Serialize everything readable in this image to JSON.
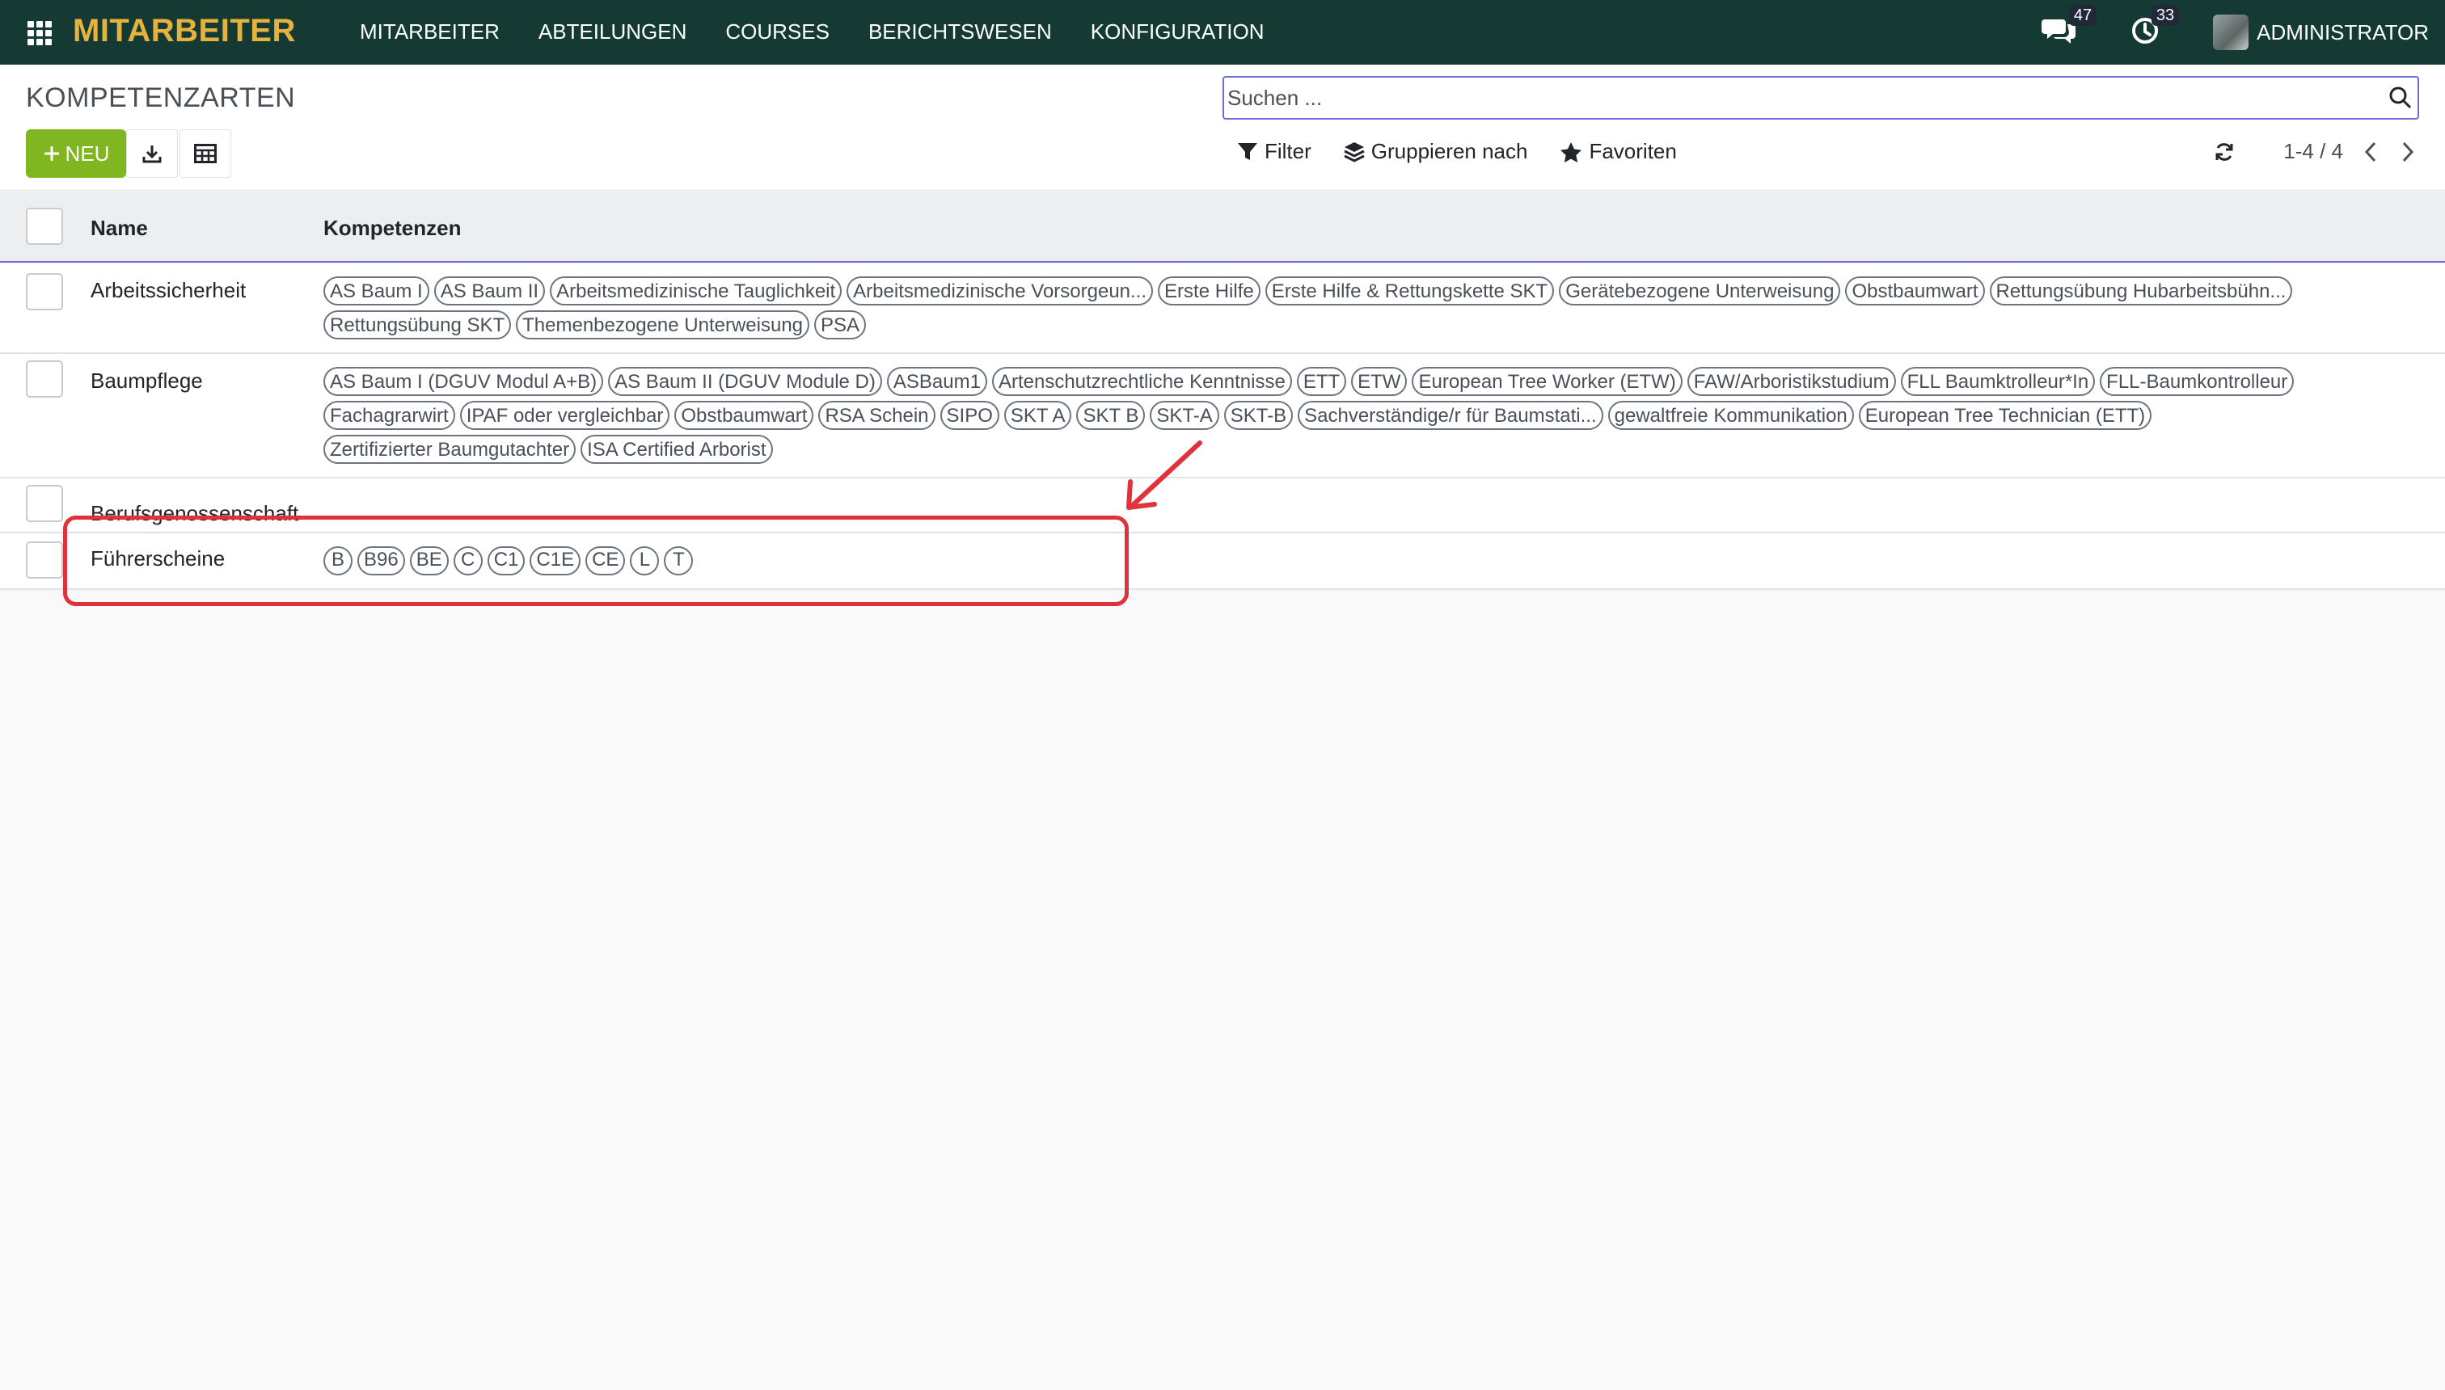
{
  "navbar": {
    "brand": "MITARBEITER",
    "menu": [
      {
        "label": "MITARBEITER"
      },
      {
        "label": "ABTEILUNGEN"
      },
      {
        "label": "COURSES"
      },
      {
        "label": "BERICHTSWESEN"
      },
      {
        "label": "KONFIGURATION"
      }
    ],
    "messages_count": "47",
    "activities_count": "33",
    "user": "ADMINISTRATOR"
  },
  "control": {
    "title": "KOMPETENZARTEN",
    "new_label": "NEU",
    "search_placeholder": "Suchen ...",
    "filter_label": "Filter",
    "group_label": "Gruppieren nach",
    "favorites_label": "Favoriten",
    "pager_value": "1-4 / 4"
  },
  "list": {
    "headers": {
      "name": "Name",
      "skills": "Kompetenzen"
    },
    "rows": [
      {
        "name": "Arbeitssicherheit",
        "tags": [
          "AS Baum I",
          "AS Baum II",
          "Arbeitsmedizinische Tauglichkeit",
          "Arbeitsmedizinische Vorsorgeun...",
          "Erste Hilfe",
          "Erste Hilfe & Rettungskette SKT",
          "Gerätebezogene Unterweisung",
          "Obstbaumwart",
          "Rettungsübung Hubarbeitsbühn...",
          "Rettungsübung SKT",
          "Themenbezogene Unterweisung",
          "PSA"
        ]
      },
      {
        "name": "Baumpflege",
        "tags": [
          "AS Baum I (DGUV Modul A+B)",
          "AS Baum II (DGUV Module D)",
          "ASBaum1",
          "Artenschutzrechtliche Kenntnisse",
          "ETT",
          "ETW",
          "European Tree Worker (ETW)",
          "FAW/Arboristikstudium",
          "FLL Baumktrolleur*In",
          "FLL-Baumkontrolleur",
          "Fachagrarwirt",
          "IPAF oder vergleichbar",
          "Obstbaumwart",
          "RSA Schein",
          "SIPO",
          "SKT A",
          "SKT B",
          "SKT-A",
          "SKT-B",
          "Sachverständige/r für Baumstati...",
          "gewaltfreie Kommunikation",
          "European Tree Technician (ETT)",
          "Zertifizierter Baumgutachter",
          "ISA Certified Arborist"
        ]
      },
      {
        "name": "Berufsgenossenschaft",
        "tags": []
      },
      {
        "name": "Führerscheine",
        "tags": [
          "B",
          "B96",
          "BE",
          "C",
          "C1",
          "C1E",
          "CE",
          "L",
          "T"
        ]
      }
    ]
  },
  "colors": {
    "navbar_bg": "#143a33",
    "brand": "#e5b33d",
    "primary_button": "#80b61f",
    "annotation": "#e0313c",
    "accent": "#6f6ad4"
  }
}
